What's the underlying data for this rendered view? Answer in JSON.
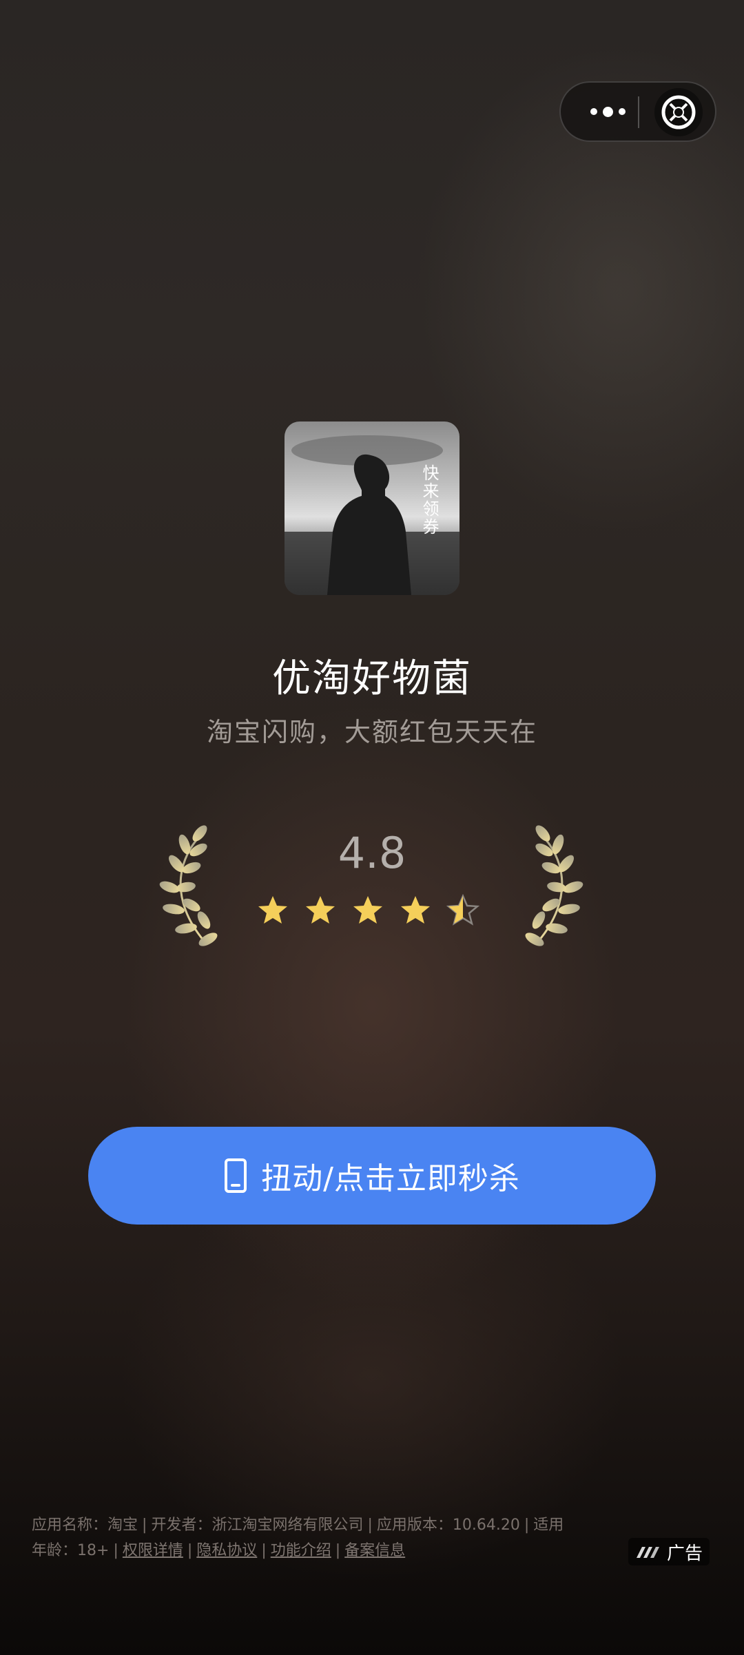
{
  "capsule": {
    "more_icon": "more-dots-icon",
    "close_icon": "close-target-icon"
  },
  "app": {
    "icon_text": "快来领券",
    "name": "优淘好物菌",
    "tagline": "淘宝闪购，大额红包天天在"
  },
  "rating": {
    "score": "4.8",
    "stars_out_of_5": 4.5
  },
  "cta": {
    "icon": "phone-icon",
    "label": "扭动/点击立即秒杀",
    "color": "#4a84f2"
  },
  "footer": {
    "app_name_label": "应用名称：淘宝",
    "developer_label": "开发者：浙江淘宝网络有限公司",
    "version_label": "应用版本：10.64.20",
    "suitable_label": "适用",
    "age_label": "年龄：18+",
    "permissions_link": "权限详情",
    "privacy_link": "隐私协议",
    "features_link": "功能介绍",
    "filing_link": "备案信息"
  },
  "ad_badge": {
    "label": "广告"
  }
}
